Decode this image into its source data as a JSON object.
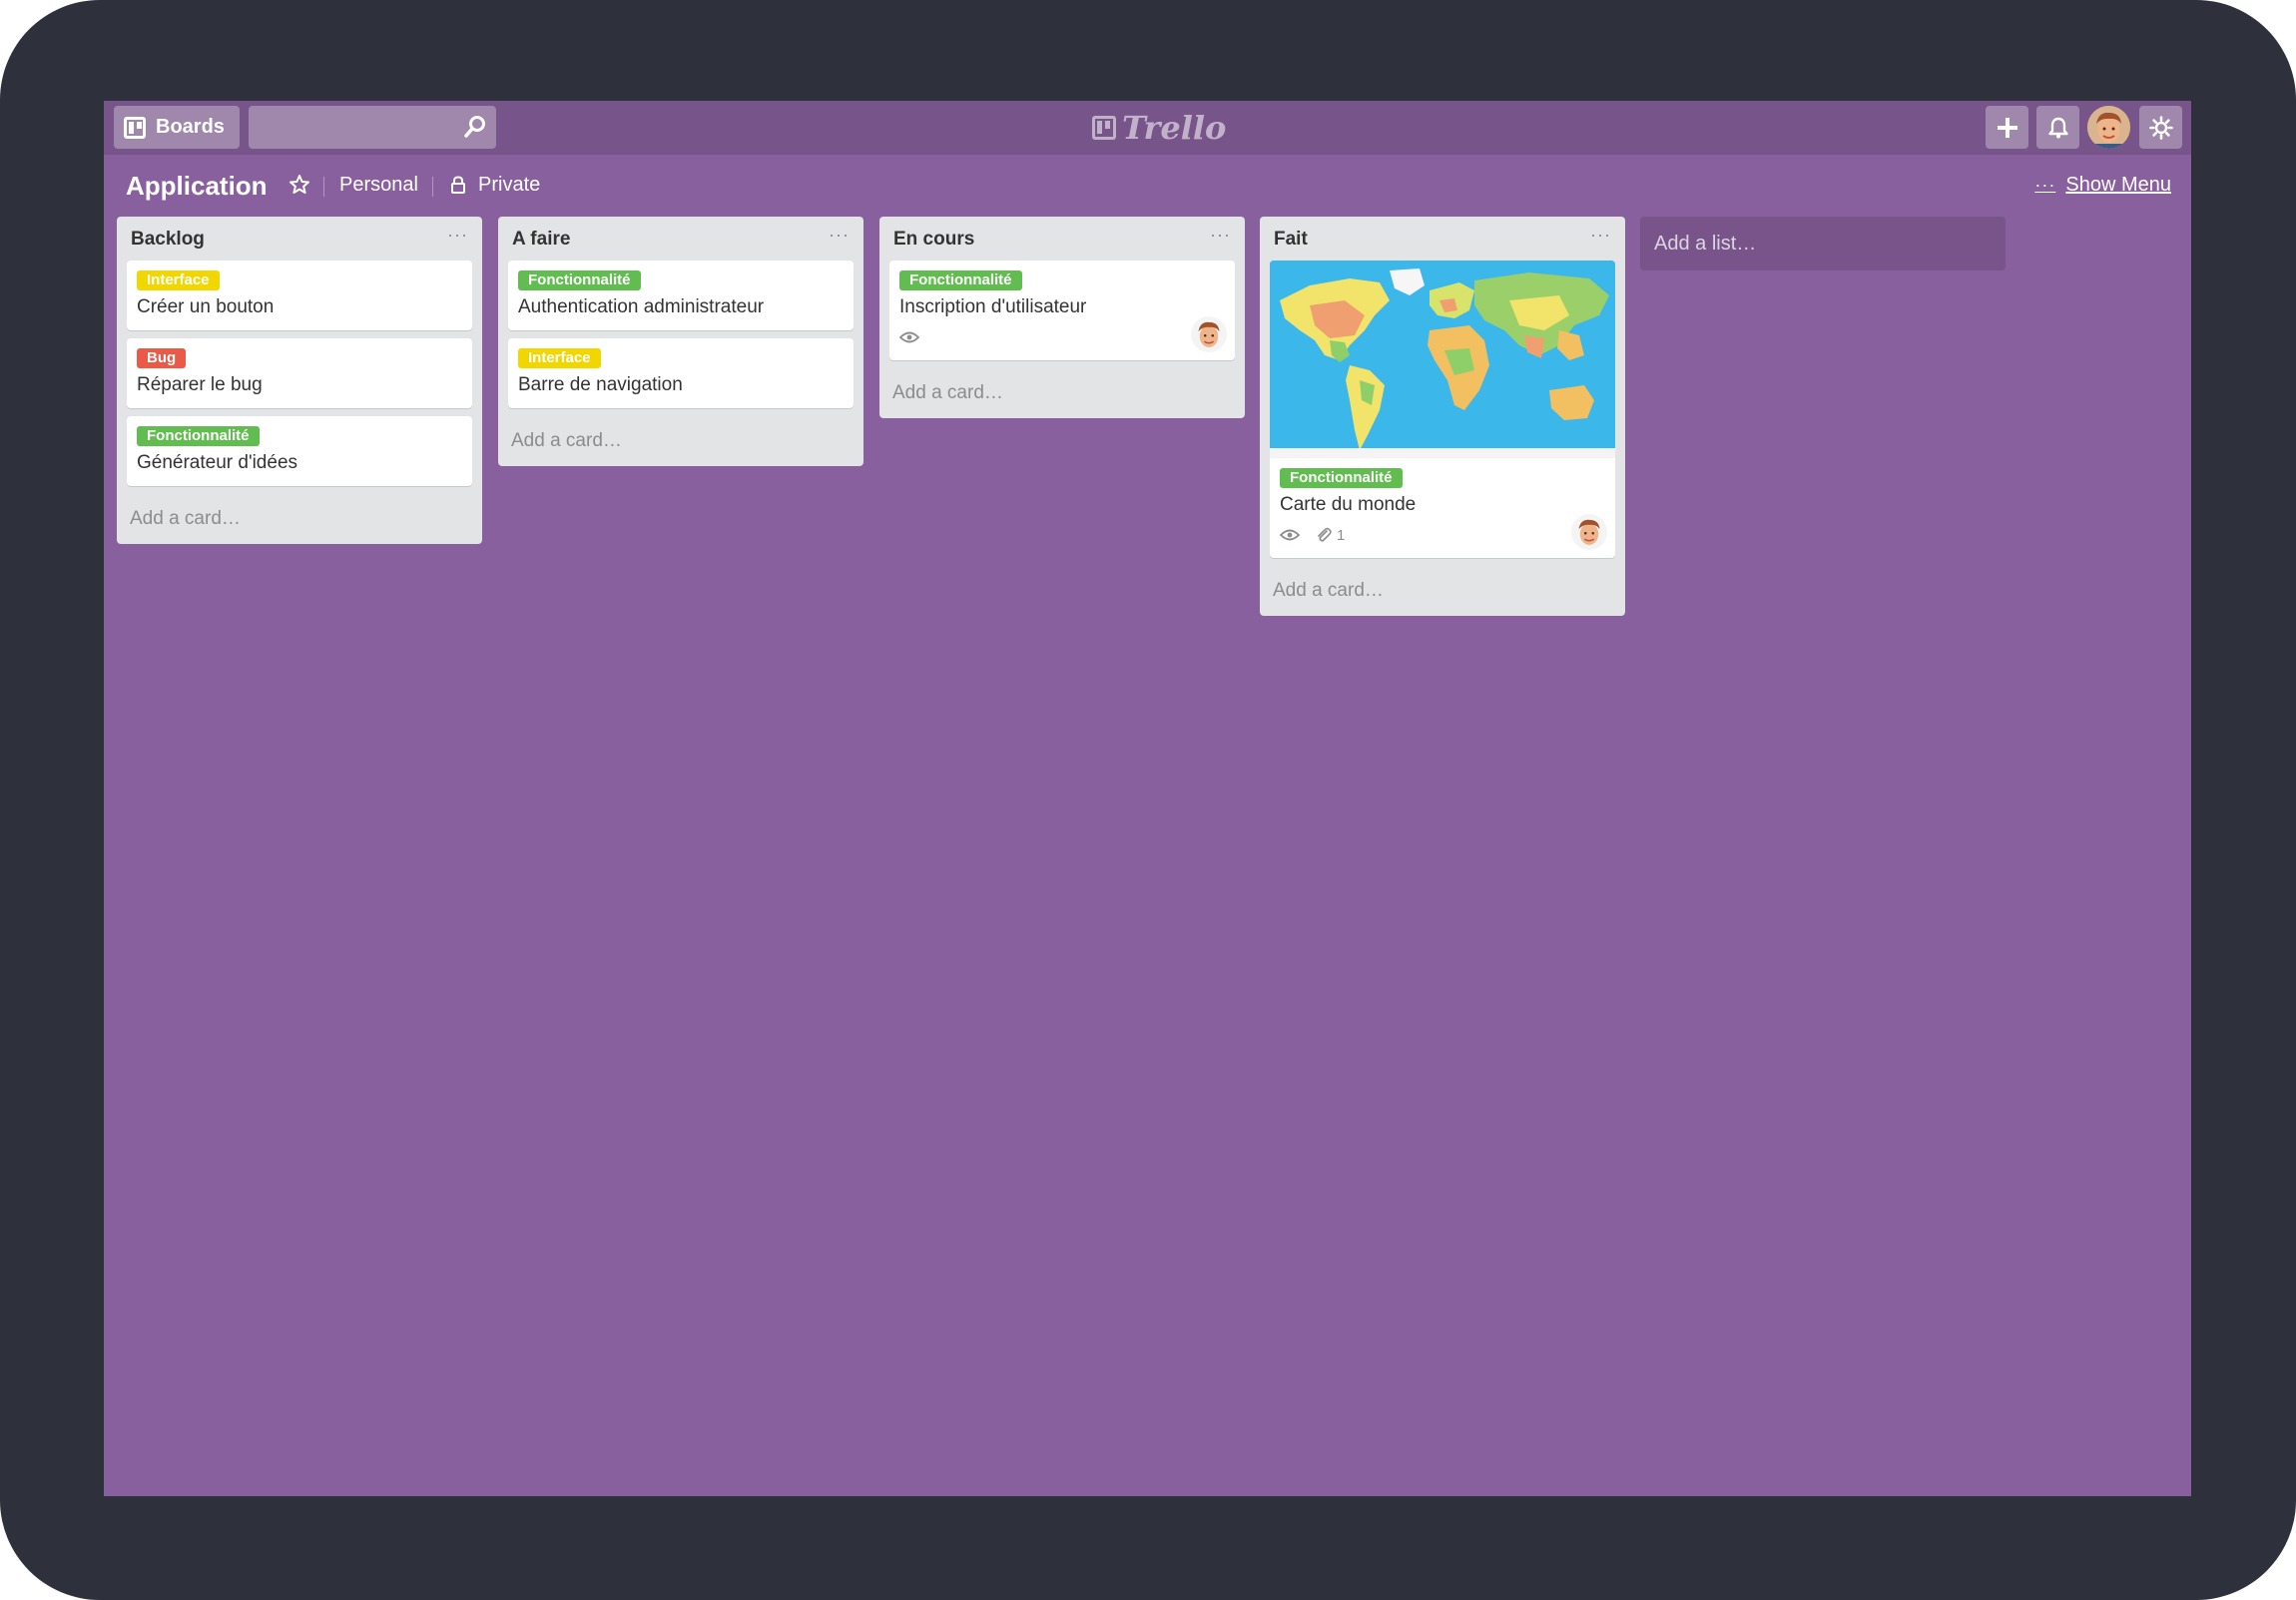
{
  "topbar": {
    "boards_label": "Boards",
    "search_placeholder": "",
    "logo_text": "Trello"
  },
  "board": {
    "title": "Application",
    "team": "Personal",
    "visibility": "Private",
    "show_menu": "Show Menu"
  },
  "lists": [
    {
      "title": "Backlog",
      "cards": [
        {
          "label": "Interface",
          "label_color": "#f2d600",
          "title": "Créer un bouton"
        },
        {
          "label": "Bug",
          "label_color": "#eb5a46",
          "title": "Réparer le bug"
        },
        {
          "label": "Fonctionnalité",
          "label_color": "#61bd4f",
          "title": "Générateur d'idées"
        }
      ],
      "add_card": "Add a card…"
    },
    {
      "title": "A faire",
      "cards": [
        {
          "label": "Fonctionnalité",
          "label_color": "#61bd4f",
          "title": "Authentication administrateur"
        },
        {
          "label": "Interface",
          "label_color": "#f2d600",
          "title": "Barre de navigation"
        }
      ],
      "add_card": "Add a card…"
    },
    {
      "title": "En cours",
      "cards": [
        {
          "label": "Fonctionnalité",
          "label_color": "#61bd4f",
          "title": "Inscription d'utilisateur",
          "watching": true
        }
      ],
      "add_card": "Add a card…"
    },
    {
      "title": "Fait",
      "cards": [
        {
          "label": "Fonctionnalité",
          "label_color": "#61bd4f",
          "title": "Carte du monde",
          "watching": true,
          "attachments": "1",
          "cover": "world-map"
        }
      ],
      "add_card": "Add a card…"
    }
  ],
  "add_list": "Add a list…",
  "colors": {
    "board_bg": "#89609e",
    "header_bg": "#775489",
    "list_bg": "#e2e4e6"
  }
}
